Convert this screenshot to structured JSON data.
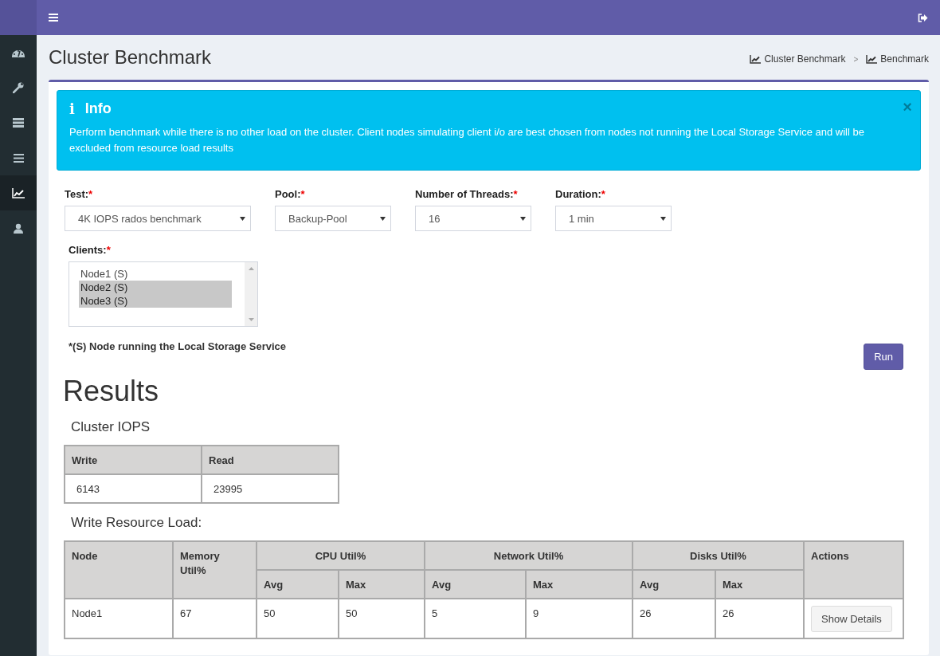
{
  "sidebar": {
    "items": [
      {
        "selected": false
      },
      {
        "selected": false
      },
      {
        "selected": false
      },
      {
        "selected": false
      },
      {
        "selected": true
      },
      {
        "selected": false
      }
    ]
  },
  "page": {
    "title": "Cluster Benchmark",
    "breadcrumb": [
      "Cluster Benchmark",
      "Benchmark"
    ],
    "breadcrumb_separator": ">"
  },
  "info": {
    "icon": "i",
    "title": "Info",
    "text": "Perform benchmark while there is no other load on the cluster. Client nodes simulating client i/o are best chosen from nodes not running the Local Storage Service and will be excluded from resource load results",
    "close": "×"
  },
  "form": {
    "required_mark": "*",
    "fields": [
      {
        "label": "Test:",
        "value": "4K IOPS rados benchmark"
      },
      {
        "label": "Pool:",
        "value": "Backup-Pool"
      },
      {
        "label": "Number of Threads:",
        "value": "16"
      },
      {
        "label": "Duration:",
        "value": "1 min"
      }
    ],
    "clients": {
      "label": "Clients:",
      "options": [
        {
          "label": "Node1 (S)",
          "selected": false
        },
        {
          "label": "Node2 (S)",
          "selected": true
        },
        {
          "label": "Node3 (S)",
          "selected": true
        }
      ]
    },
    "note": "*(S) Node running the Local Storage Service",
    "run_button": "Run"
  },
  "results": {
    "title": "Results",
    "iops": {
      "title": "Cluster IOPS",
      "columns": [
        "Write",
        "Read"
      ],
      "row": [
        "6143",
        "23995"
      ]
    },
    "write_load": {
      "title": "Write Resource Load:",
      "header_rows": [
        [
          {
            "label": "Node",
            "rowspan": 2
          },
          {
            "label": "Memory Util%",
            "rowspan": 2
          },
          {
            "label": "CPU Util%",
            "colspan": 2
          },
          {
            "label": "Network Util%",
            "colspan": 2
          },
          {
            "label": "Disks Util%",
            "colspan": 2
          },
          {
            "label": "Actions",
            "rowspan": 2
          }
        ],
        [
          {
            "label": "Avg"
          },
          {
            "label": "Max"
          },
          {
            "label": "Avg"
          },
          {
            "label": "Max"
          },
          {
            "label": "Avg"
          },
          {
            "label": "Max"
          }
        ]
      ],
      "rows": [
        {
          "cells": [
            "Node1",
            "67",
            "50",
            "50",
            "5",
            "9",
            "26",
            "26"
          ],
          "action": "Show Details"
        }
      ]
    }
  }
}
